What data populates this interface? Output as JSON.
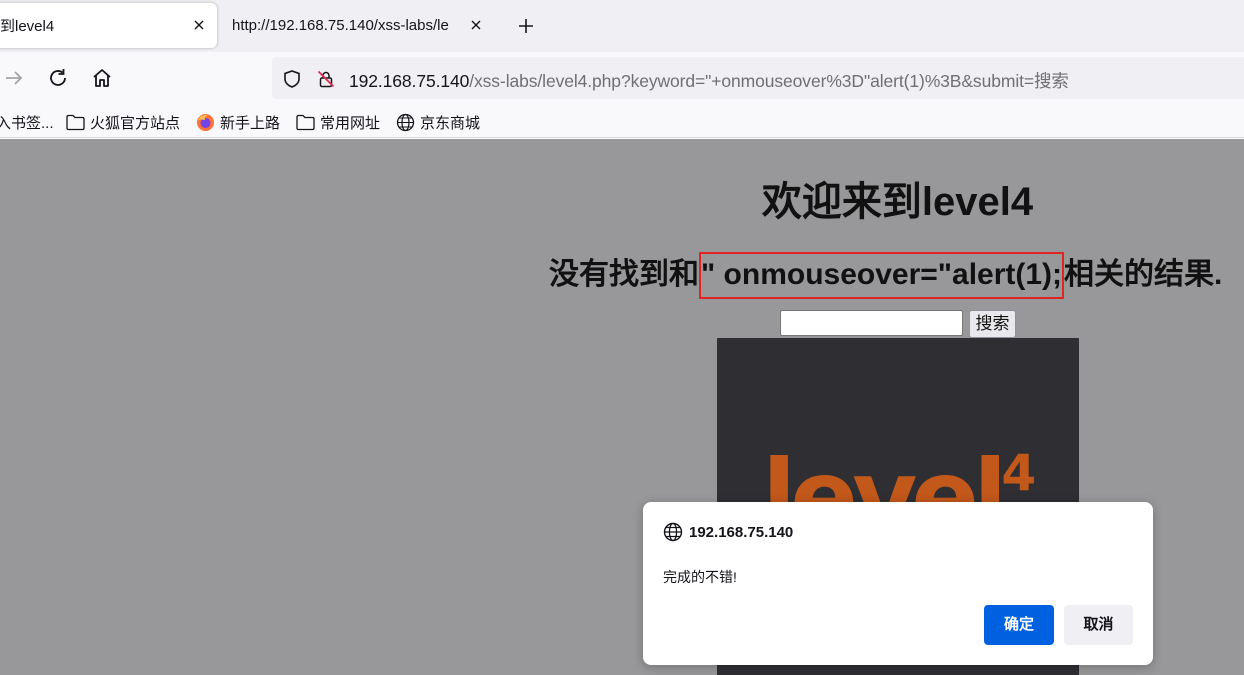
{
  "tabs": [
    {
      "title": "到level4",
      "active": true
    },
    {
      "title": "http://192.168.75.140/xss-labs/le",
      "active": false
    }
  ],
  "url": {
    "host": "192.168.75.140",
    "path": "/xss-labs/level4.php?keyword=\"+onmouseover%3D\"alert(1)%3B&submit=搜索"
  },
  "bookmarks": [
    {
      "label": "入书签...",
      "icon": "none"
    },
    {
      "label": "火狐官方站点",
      "icon": "folder-icon"
    },
    {
      "label": "新手上路",
      "icon": "firefox-icon"
    },
    {
      "label": "常用网址",
      "icon": "folder-icon"
    },
    {
      "label": "京东商城",
      "icon": "globe-icon"
    }
  ],
  "page": {
    "heading": "欢迎来到level4",
    "result_prefix": "没有找到和",
    "result_keyword": "\" onmouseover=\"alert(1);",
    "result_suffix": "相关的结果.",
    "search_value": "",
    "search_button": "搜索",
    "logo_text": "level",
    "logo_number": "4"
  },
  "dialog": {
    "origin": "192.168.75.140",
    "message": "完成的不错!",
    "ok_label": "确定",
    "cancel_label": "取消"
  },
  "colors": {
    "page_background": "#98989a",
    "highlight_border": "#e02424",
    "dialog_primary": "#0061e0",
    "logo_orange": "#c2581a"
  }
}
